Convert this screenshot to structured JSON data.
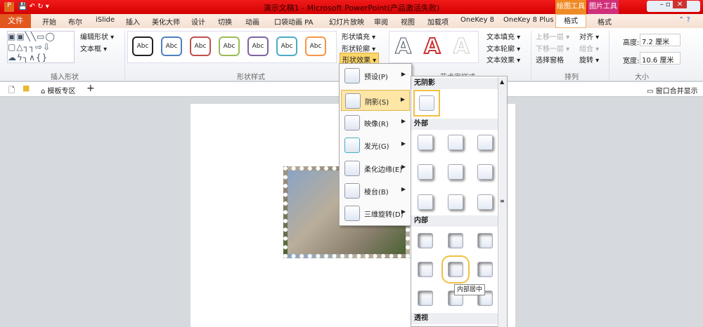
{
  "window": {
    "title": "演示文稿1 - Microsoft PowerPoint(产品激活失败)",
    "context_tabs": [
      "绘图工具",
      "图片工具"
    ]
  },
  "tabs": [
    "文件",
    "开始",
    "布尔",
    "iSlide",
    "插入",
    "美化大师",
    "设计",
    "切换",
    "动画",
    "口袋动画 PA",
    "幻灯片放映",
    "审阅",
    "视图",
    "加载项",
    "OneKey 8",
    "OneKey 8 Plus",
    "格式",
    "格式"
  ],
  "ribbon": {
    "insert_shapes": {
      "edit_shape": "编辑形状 ▾",
      "textbox": "文本框 ▾",
      "label": "插入形状"
    },
    "shape_styles": {
      "samples": [
        "Abc",
        "Abc",
        "Abc",
        "Abc",
        "Abc",
        "Abc",
        "Abc"
      ],
      "colors": [
        "#222222",
        "#4f81bd",
        "#c0504d",
        "#9bbb59",
        "#8064a2",
        "#4bacc6",
        "#f79646"
      ],
      "fill": "形状填充 ▾",
      "outline": "形状轮廓 ▾",
      "effects": "形状效果 ▾",
      "label": "形状样式"
    },
    "wordart": {
      "text_fill": "文本填充 ▾",
      "text_outline": "文本轮廓 ▾",
      "text_effects": "文本效果 ▾",
      "label": "艺术字样式"
    },
    "arrange": {
      "bring_forward": "上移一层 ▾",
      "send_backward": "下移一层 ▾",
      "selection_pane": "选择窗格",
      "align": "对齐 ▾",
      "group": "组合 ▾",
      "rotate": "旋转 ▾",
      "label": "排列"
    },
    "size": {
      "height_label": "高度:",
      "height": "7.2 厘米",
      "width_label": "宽度:",
      "width": "10.6 厘米",
      "label": "大小"
    }
  },
  "quickbar": {
    "template_zone": "模板专区",
    "add": "+",
    "merge_windows": "窗口合并显示"
  },
  "effects_menu": [
    {
      "label": "预设(P)"
    },
    {
      "label": "阴影(S)"
    },
    {
      "label": "映像(R)"
    },
    {
      "label": "发光(G)"
    },
    {
      "label": "柔化边缘(E)"
    },
    {
      "label": "棱台(B)"
    },
    {
      "label": "三维旋转(D)"
    }
  ],
  "shadow_gallery": {
    "no_shadow": "无阴影",
    "outer": "外部",
    "inner": "内部",
    "perspective": "透视",
    "tooltip": "内部居中"
  }
}
